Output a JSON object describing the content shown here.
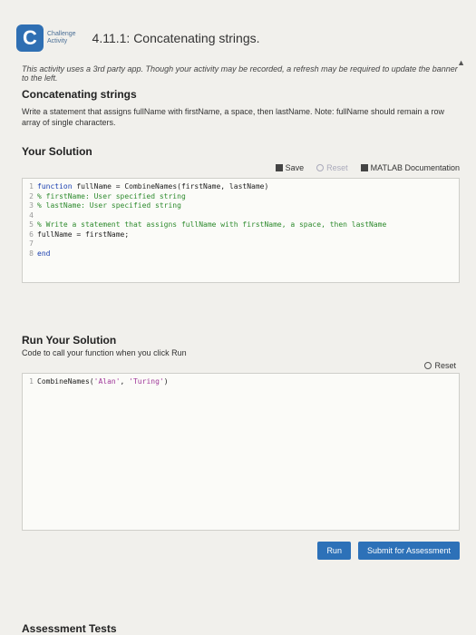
{
  "header": {
    "logo_letter": "C",
    "logo_sub_line1": "Challenge",
    "logo_sub_line2": "Activity",
    "title": "4.11.1: Concatenating strings."
  },
  "notice": "This activity uses a 3rd party app. Though your activity may be recorded, a refresh may be required to update the banner to the left.",
  "task": {
    "heading": "Concatenating strings",
    "description": "Write a statement that assigns fullName with firstName, a space, then lastName. Note: fullName should remain a row array of single characters."
  },
  "solution": {
    "heading": "Your Solution",
    "save_label": "Save",
    "reset_label": "Reset",
    "docs_label": "MATLAB Documentation",
    "code": [
      {
        "n": "1",
        "kw": "function ",
        "txt": "fullName = CombineNames(firstName, lastName)",
        "cm": ""
      },
      {
        "n": "2",
        "kw": "",
        "txt": "",
        "cm": "% firstName: User specified string"
      },
      {
        "n": "3",
        "kw": "",
        "txt": "",
        "cm": "% lastName: User specified string"
      },
      {
        "n": "4",
        "kw": "",
        "txt": "",
        "cm": ""
      },
      {
        "n": "5",
        "kw": "",
        "txt": "",
        "cm": "% Write a statement that assigns fullName with firstName, a space, then lastName"
      },
      {
        "n": "6",
        "kw": "",
        "txt": "fullName = firstName;",
        "cm": ""
      },
      {
        "n": "7",
        "kw": "",
        "txt": "",
        "cm": ""
      },
      {
        "n": "8",
        "kw": "end",
        "txt": "",
        "cm": ""
      }
    ]
  },
  "run": {
    "heading": "Run Your Solution",
    "subtext": "Code to call your function when you click Run",
    "reset_label": "Reset",
    "line_no": "1",
    "call_prefix": "CombineNames(",
    "arg1": "'Alan'",
    "sep": ", ",
    "arg2": "'Turing'",
    "call_suffix": ")"
  },
  "actions": {
    "run_label": "Run",
    "submit_label": "Submit for Assessment"
  },
  "bottom": {
    "heading": "Assessment Tests"
  }
}
